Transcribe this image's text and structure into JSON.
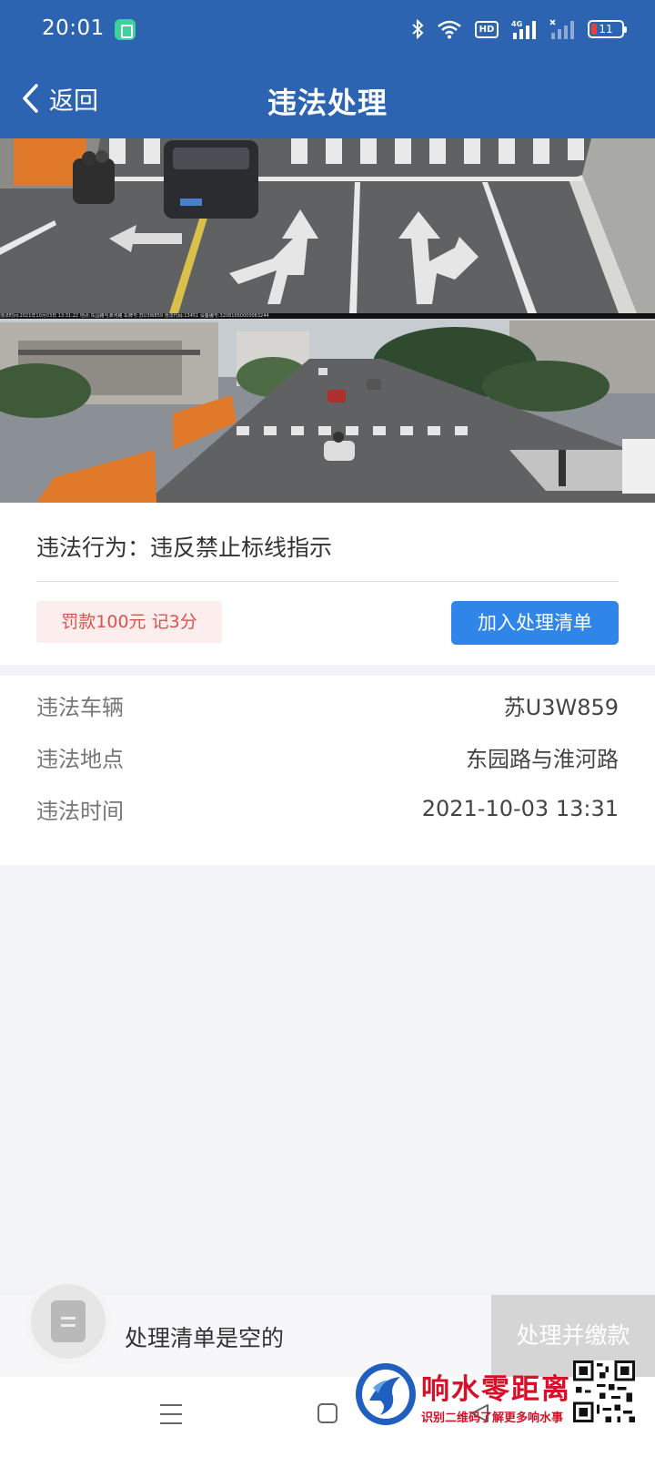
{
  "status_bar": {
    "time": "20:01",
    "hd_label": "HD",
    "network_label": "4G",
    "battery_level": "11",
    "icons": [
      "app-notification-icon",
      "bluetooth-icon",
      "wifi-icon",
      "hd-icon",
      "signal-4g-icon",
      "signal-no-service-icon",
      "battery-icon"
    ]
  },
  "header": {
    "back_label": "返回",
    "title": "违法处理"
  },
  "photo": {
    "stamp_text": "违法时间:2021年10月03日 13:31:22  地点:东园路与淮河路  车牌号:苏U3W859  违法代码:13451  设备编号:32081060000063244"
  },
  "violation": {
    "behavior_label": "违法行为：",
    "behavior_value": "违反禁止标线指示",
    "penalty": "罚款100元 记3分",
    "add_button": "加入处理清单"
  },
  "details": [
    {
      "label": "违法车辆",
      "value": "苏U3W859"
    },
    {
      "label": "违法地点",
      "value": "东园路与淮河路"
    },
    {
      "label": "违法时间",
      "value": "2021-10-03 13:31"
    }
  ],
  "action_bar": {
    "empty_text": "处理清单是空的",
    "pay_button": "处理并缴款"
  },
  "watermark": {
    "title": "响水零距离",
    "subtitle": "识别二维码了解更多响水事"
  },
  "colors": {
    "header_bg": "#2c64b2",
    "primary_button": "#2f86e8",
    "penalty_text": "#d9534f",
    "penalty_bg": "#fdeeee",
    "disabled_button": "#d5d5d5",
    "watermark_red": "#d7102a"
  }
}
